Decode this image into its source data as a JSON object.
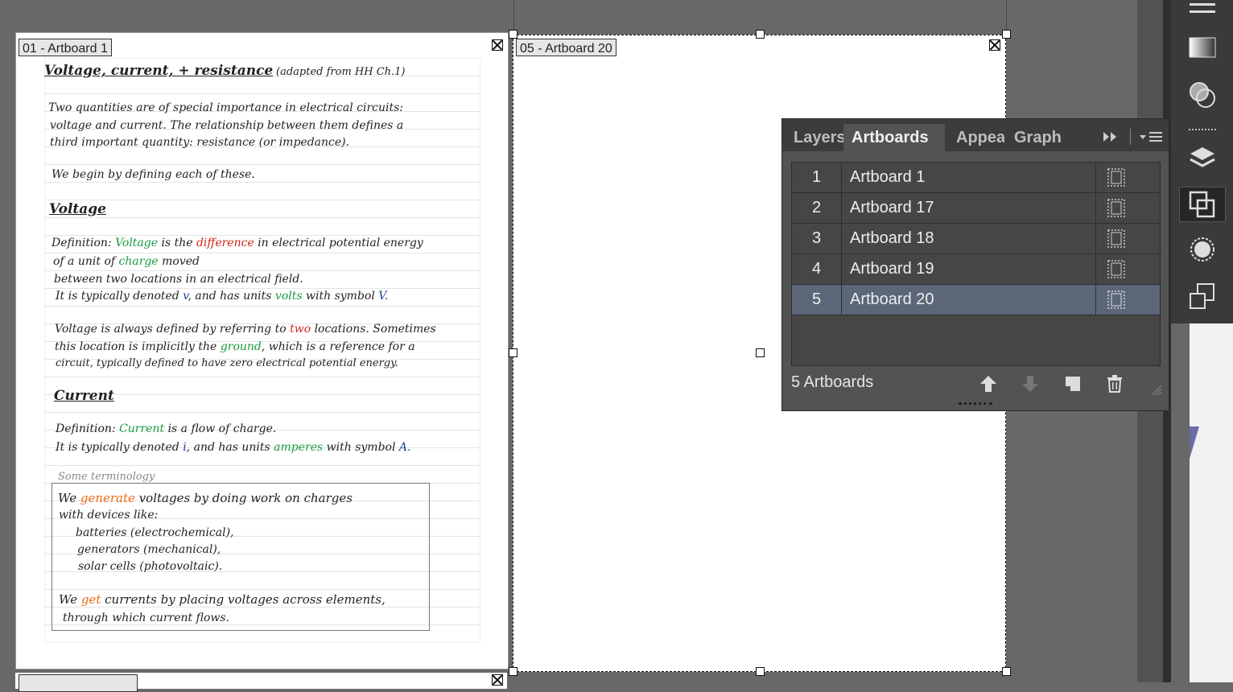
{
  "artboard1": {
    "label": "01 - Artboard 1",
    "notes": {
      "title": "Voltage, current, + resistance",
      "title_note": "(adapted from HH Ch.1)",
      "intro": [
        "Two quantities are of special importance in electrical circuits:",
        "voltage and current. The relationship between them defines a",
        "third important quantity: resistance (or impedance)."
      ],
      "begin": "We begin by defining each of these.",
      "voltage_heading": "Voltage",
      "voltage_def_prefix": "Definition:",
      "voltage_word": "Voltage",
      "voltage_def_mid": "is the",
      "difference_word": "difference",
      "voltage_def_end": "in electrical potential energy",
      "voltage_def2_a": "of a unit of",
      "charge_word": "charge",
      "voltage_def2_b": "moved",
      "voltage_def3": "between two locations in an electrical field.",
      "voltage_def4_a": "It is typically denoted",
      "v_symbol": "v",
      "voltage_def4_b": ", and has units",
      "volts_word": "volts",
      "voltage_def4_c": "with symbol",
      "V_symbol": "V.",
      "ref_a": "Voltage is always defined by referring to",
      "two_word": "two",
      "ref_b": "locations. Sometimes",
      "ref2_a": "this location is implicitly the",
      "ground_word": "ground",
      "ref2_b": ", which is a reference for a",
      "ref3": "circuit, typically defined to have zero electrical potential energy.",
      "current_heading": "Current",
      "current_def_prefix": "Definition:",
      "current_word": "Current",
      "current_def_end": "is a flow of charge.",
      "current_def2_a": "It is typically denoted",
      "i_symbol": "i",
      "current_def2_b": ", and has units",
      "amperes_word": "amperes",
      "current_def2_c": "with symbol",
      "A_symbol": "A.",
      "terminology": "Some terminology",
      "gen_a": "We",
      "generate_word": "generate",
      "gen_b": "voltages by doing work on charges",
      "gen2": "with devices like:",
      "gen3": "batteries (electrochemical),",
      "gen4": "generators (mechanical),",
      "gen5": "solar cells (photovoltaic).",
      "get_a": "We",
      "get_word": "get",
      "get_b": "currents by placing voltages across elements,",
      "get2": "through which current flows."
    }
  },
  "artboard20": {
    "label": "05 - Artboard 20"
  },
  "panel": {
    "tabs": [
      "Layers",
      "Artboards",
      "Appearance",
      "Graph"
    ],
    "rows": [
      {
        "num": "1",
        "name": "Artboard 1"
      },
      {
        "num": "2",
        "name": "Artboard 17"
      },
      {
        "num": "3",
        "name": "Artboard 18"
      },
      {
        "num": "4",
        "name": "Artboard 19"
      },
      {
        "num": "5",
        "name": "Artboard 20"
      }
    ],
    "selected_row": 5,
    "count_label": "5 Artboards"
  },
  "colors": {
    "selected_row": "#5b6679",
    "panel_bg": "#535353",
    "canvas_bg": "#686868"
  }
}
